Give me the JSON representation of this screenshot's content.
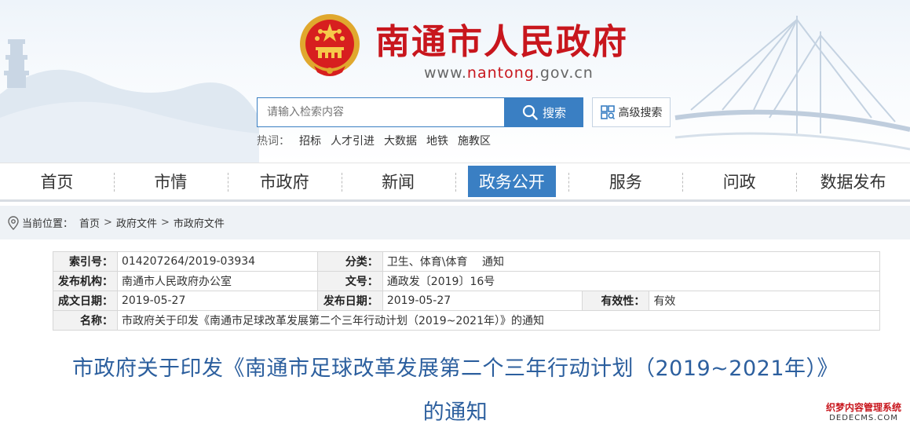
{
  "header": {
    "site_title": "南通市人民政府",
    "url_prefix": "www.",
    "url_brand": "nantong",
    "url_suffix": ".gov.cn"
  },
  "search": {
    "placeholder": "请输入检索内容",
    "button_label": "搜索",
    "advanced_label": "高级搜索"
  },
  "hot_words": {
    "label": "热词：",
    "items": [
      "招标",
      "人才引进",
      "大数据",
      "地铁",
      "施教区"
    ]
  },
  "nav": {
    "items": [
      "首页",
      "市情",
      "市政府",
      "新闻",
      "政务公开",
      "服务",
      "问政",
      "数据发布"
    ],
    "active": "政务公开"
  },
  "breadcrumb": {
    "label": "当前位置：",
    "items": [
      "首页",
      "政府文件",
      "市政府文件"
    ]
  },
  "info": {
    "index_key": "索引号：",
    "index_val": "014207264/2019-03934",
    "category_key": "分类：",
    "category_val": "卫生、体育\\体育　 通知",
    "publisher_key": "发布机构：",
    "publisher_val": "南通市人民政府办公室",
    "docno_key": "文号：",
    "docno_val": "通政发〔2019〕16号",
    "created_key": "成文日期：",
    "created_val": "2019-05-27",
    "published_key": "发布日期：",
    "published_val": "2019-05-27",
    "valid_key": "有效性：",
    "valid_val": "有效",
    "name_key": "名称：",
    "name_val": "市政府关于印发《南通市足球改革发展第二个三年行动计划（2019~2021年）》的通知"
  },
  "article": {
    "title_line1": "市政府关于印发《南通市足球改革发展第二个三年行动计划（2019~2021年）》",
    "title_line2": "的通知"
  },
  "watermark": {
    "line1": "织梦内容管理系统",
    "line2": "DEDECMS.COM"
  },
  "colors": {
    "brand_red": "#c8161d",
    "primary_blue": "#3a7fc3",
    "title_blue": "#2c5f9e"
  }
}
